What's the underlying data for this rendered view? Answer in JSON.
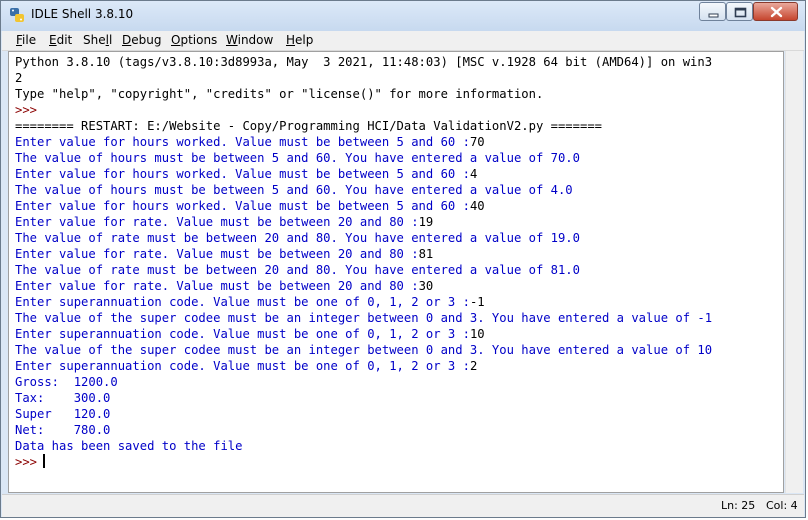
{
  "window": {
    "title": "IDLE Shell 3.8.10",
    "controls": [
      "minimize-icon",
      "maximize-icon",
      "close-icon"
    ]
  },
  "menu": [
    {
      "mnemonic": "F",
      "rest": "ile"
    },
    {
      "mnemonic": "E",
      "rest": "dit"
    },
    {
      "pre": "She",
      "mnemonic": "l",
      "rest": "l"
    },
    {
      "mnemonic": "D",
      "rest": "ebug"
    },
    {
      "mnemonic": "O",
      "rest": "ptions"
    },
    {
      "mnemonic": "W",
      "rest": "indow"
    },
    {
      "mnemonic": "H",
      "rest": "elp"
    }
  ],
  "shell": {
    "colors": {
      "stdout": "#0000c8",
      "prompt": "#8b0000",
      "plain": "#000000"
    },
    "lines": [
      {
        "type": "plain",
        "text": "Python 3.8.10 (tags/v3.8.10:3d8993a, May  3 2021, 11:48:03) [MSC v.1928 64 bit (AMD64)] on win3"
      },
      {
        "type": "plain",
        "text": "2"
      },
      {
        "type": "plain",
        "text": "Type \"help\", \"copyright\", \"credits\" or \"license()\" for more information."
      },
      {
        "type": "prompt",
        "text": ">>> "
      },
      {
        "type": "plain",
        "text": "======== RESTART: E:/Website - Copy/Programming HCI/Data ValidationV2.py ======="
      },
      {
        "type": "stdout",
        "text": "Enter value for hours worked. Value must be between 5 and 60 :",
        "input": "70"
      },
      {
        "type": "stdout",
        "text": "The value of hours must be between 5 and 60. You have entered a value of 70.0"
      },
      {
        "type": "stdout",
        "text": "Enter value for hours worked. Value must be between 5 and 60 :",
        "input": "4"
      },
      {
        "type": "stdout",
        "text": "The value of hours must be between 5 and 60. You have entered a value of 4.0"
      },
      {
        "type": "stdout",
        "text": "Enter value for hours worked. Value must be between 5 and 60 :",
        "input": "40"
      },
      {
        "type": "stdout",
        "text": "Enter value for rate. Value must be between 20 and 80 :",
        "input": "19"
      },
      {
        "type": "stdout",
        "text": "The value of rate must be between 20 and 80. You have entered a value of 19.0"
      },
      {
        "type": "stdout",
        "text": "Enter value for rate. Value must be between 20 and 80 :",
        "input": "81"
      },
      {
        "type": "stdout",
        "text": "The value of rate must be between 20 and 80. You have entered a value of 81.0"
      },
      {
        "type": "stdout",
        "text": "Enter value for rate. Value must be between 20 and 80 :",
        "input": "30"
      },
      {
        "type": "stdout",
        "text": "Enter superannuation code. Value must be one of 0, 1, 2 or 3 :",
        "input": "-1"
      },
      {
        "type": "stdout",
        "text": "The value of the super codee must be an integer between 0 and 3. You have entered a value of -1"
      },
      {
        "type": "stdout",
        "text": "Enter superannuation code. Value must be one of 0, 1, 2 or 3 :",
        "input": "10"
      },
      {
        "type": "stdout",
        "text": "The value of the super codee must be an integer between 0 and 3. You have entered a value of 10"
      },
      {
        "type": "stdout",
        "text": "Enter superannuation code. Value must be one of 0, 1, 2 or 3 :",
        "input": "2"
      },
      {
        "type": "stdout",
        "text": "Gross:  1200.0"
      },
      {
        "type": "stdout",
        "text": "Tax:    300.0"
      },
      {
        "type": "stdout",
        "text": "Super   120.0"
      },
      {
        "type": "stdout",
        "text": "Net:    780.0"
      },
      {
        "type": "stdout",
        "text": "Data has been saved to the file"
      },
      {
        "type": "prompt",
        "text": ">>>",
        "cursor": true
      }
    ]
  },
  "status": {
    "line": "Ln: 25",
    "col": "Col: 4"
  }
}
